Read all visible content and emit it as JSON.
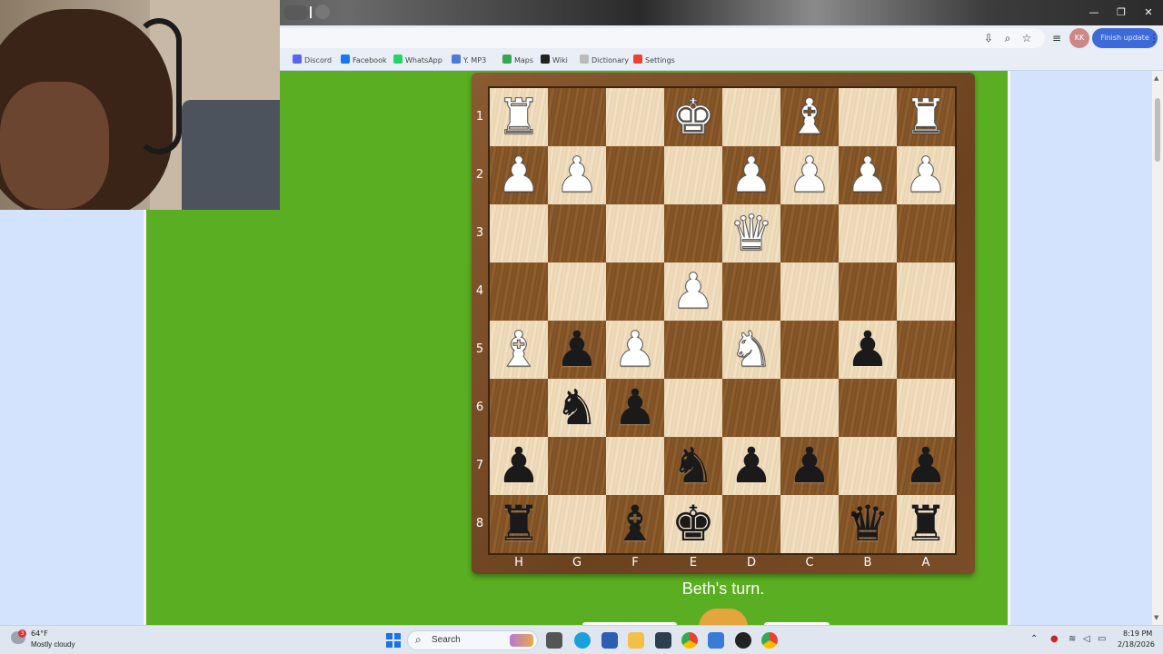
{
  "browser": {
    "finish_update_label": "Finish update",
    "avatar_initials": "KK",
    "bookmarks": [
      {
        "label": "Discord",
        "icon": "discord-icon",
        "color": "#5865f2"
      },
      {
        "label": "Facebook",
        "icon": "facebook-icon",
        "color": "#1877f2"
      },
      {
        "label": "WhatsApp",
        "icon": "whatsapp-icon",
        "color": "#25d366"
      },
      {
        "label": "Y. MP3",
        "icon": "mp3-icon",
        "color": "#4a7bd8"
      },
      {
        "label": "Maps",
        "icon": "maps-icon",
        "color": "#34a853"
      },
      {
        "label": "Wiki",
        "icon": "wiki-icon",
        "color": "#222222"
      },
      {
        "label": "Dictionary",
        "icon": "dictionary-icon",
        "color": "#bbbbbb"
      },
      {
        "label": "Settings",
        "icon": "google-icon",
        "color": "#ea4335"
      }
    ]
  },
  "board": {
    "rank_labels": [
      "1",
      "2",
      "3",
      "4",
      "5",
      "6",
      "7",
      "8"
    ],
    "file_labels": [
      "H",
      "G",
      "F",
      "E",
      "D",
      "C",
      "B",
      "A"
    ],
    "squares": [
      [
        "wR",
        "",
        "",
        "wK",
        "",
        "wB",
        "",
        "wR"
      ],
      [
        "wP",
        "wP",
        "",
        "",
        "wP",
        "wP",
        "wP",
        "wP"
      ],
      [
        "",
        "",
        "",
        "",
        "wQ",
        "",
        "",
        ""
      ],
      [
        "",
        "",
        "",
        "wP",
        "",
        "",
        "",
        ""
      ],
      [
        "wB",
        "bP",
        "wP",
        "",
        "wN",
        "",
        "bP",
        ""
      ],
      [
        "",
        "bN",
        "bP",
        "",
        "",
        "",
        "",
        ""
      ],
      [
        "bP",
        "",
        "",
        "bN",
        "bP",
        "bP",
        "",
        "bP"
      ],
      [
        "bR",
        "",
        "bB",
        "bK",
        "",
        "",
        "bQ",
        "bR"
      ]
    ],
    "light_color": "#f1dfc2",
    "dark_color": "#8a5a2b"
  },
  "game": {
    "turn_text": "Beth's turn."
  },
  "taskbar": {
    "weather_temp": "64°F",
    "weather_desc": "Mostly cloudy",
    "weather_badge": "3",
    "search_label": "Search",
    "clock_time": "8:19 PM",
    "clock_date": "2/18/2026"
  }
}
